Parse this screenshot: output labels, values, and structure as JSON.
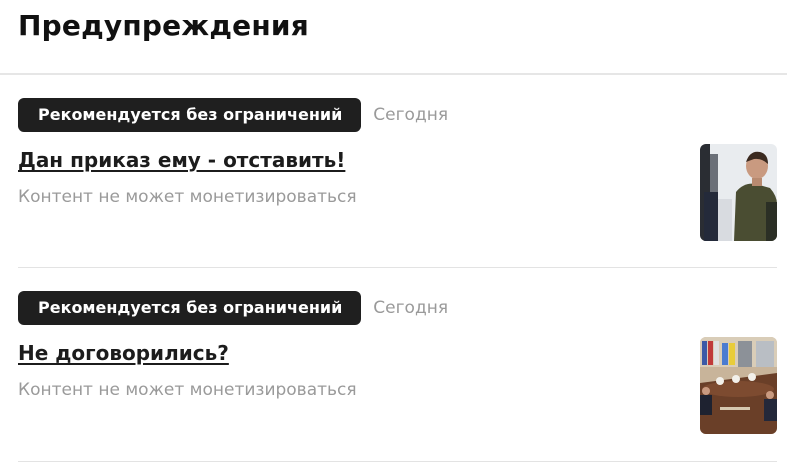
{
  "page": {
    "title": "Предупреждения"
  },
  "warnings": [
    {
      "badge": "Рекомендуется без ограничений",
      "date": "Сегодня",
      "title": "Дан приказ ему - отставить!",
      "subtitle": "Контент не может монетизироваться",
      "thumbnail": "man-in-military-jacket-photo"
    },
    {
      "badge": "Рекомендуется без ограничений",
      "date": "Сегодня",
      "title": "Не договорились?",
      "subtitle": "Контент не может монетизироваться",
      "thumbnail": "meeting-table-with-flags-photo"
    }
  ],
  "colors": {
    "badge_bg": "#1f1f1f",
    "muted_text": "#9a9a9a",
    "divider": "#e3e3e3"
  }
}
